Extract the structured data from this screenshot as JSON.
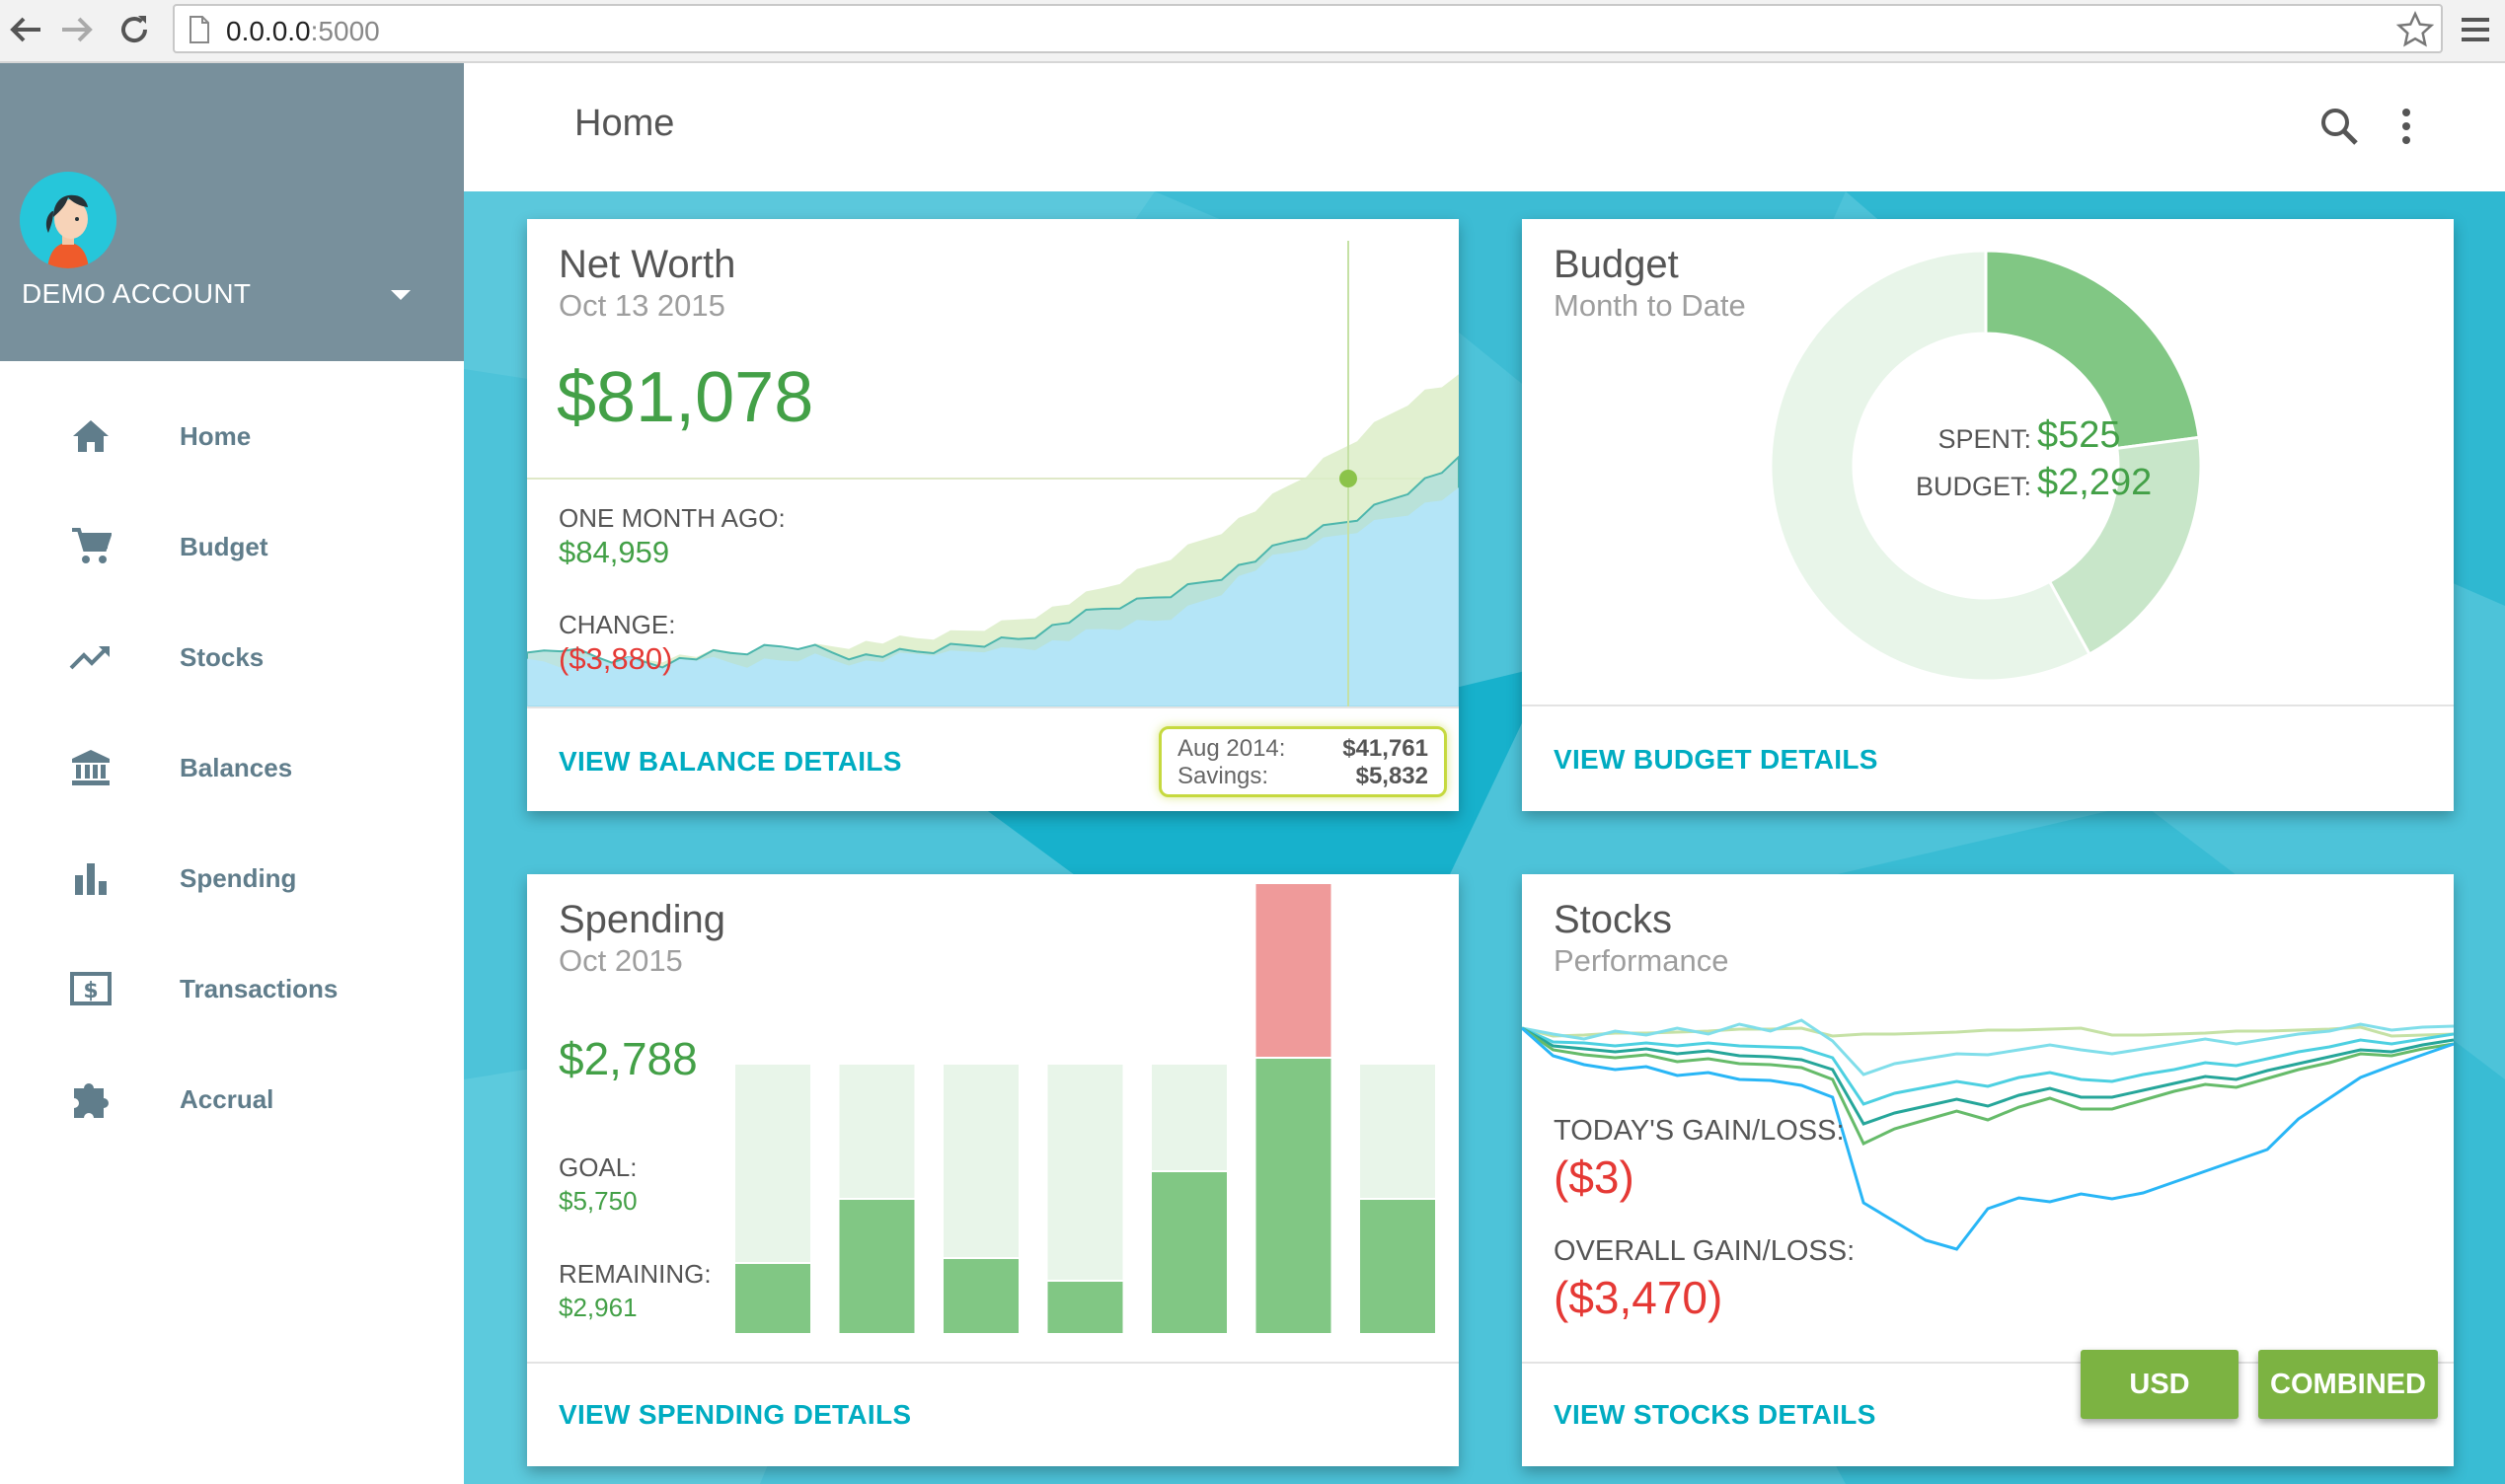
{
  "browser": {
    "url_host": "0.0.0.0",
    "url_port": ":5000"
  },
  "account": {
    "name": "DEMO ACCOUNT"
  },
  "nav": [
    {
      "label": "Home",
      "icon": "home-icon"
    },
    {
      "label": "Budget",
      "icon": "cart-icon"
    },
    {
      "label": "Stocks",
      "icon": "trending-up-icon"
    },
    {
      "label": "Balances",
      "icon": "bank-icon"
    },
    {
      "label": "Spending",
      "icon": "bar-chart-icon"
    },
    {
      "label": "Transactions",
      "icon": "dollar-bill-icon"
    },
    {
      "label": "Accrual",
      "icon": "puzzle-icon"
    }
  ],
  "header": {
    "title": "Home"
  },
  "net_worth": {
    "title": "Net Worth",
    "date": "Oct 13 2015",
    "value": "$81,078",
    "one_month_label": "ONE MONTH AGO:",
    "one_month_value": "$84,959",
    "change_label": "CHANGE:",
    "change_value": "($3,880)",
    "link": "VIEW BALANCE DETAILS",
    "tooltip": {
      "row1_label": "Aug 2014:",
      "row1_value": "$41,761",
      "row2_label": "Savings:",
      "row2_value": "$5,832"
    }
  },
  "budget": {
    "title": "Budget",
    "subtitle": "Month to Date",
    "spent_label": "SPENT:",
    "spent_value": "$525",
    "budget_label": "BUDGET:",
    "budget_value": "$2,292",
    "link": "VIEW BUDGET DETAILS"
  },
  "spending": {
    "title": "Spending",
    "subtitle": "Oct 2015",
    "value": "$2,788",
    "goal_label": "GOAL:",
    "goal_value": "$5,750",
    "remaining_label": "REMAINING:",
    "remaining_value": "$2,961",
    "link": "VIEW SPENDING DETAILS"
  },
  "stocks": {
    "title": "Stocks",
    "subtitle": "Performance",
    "today_label": "TODAY'S GAIN/LOSS:",
    "today_value": "($3)",
    "overall_label": "OVERALL GAIN/LOSS:",
    "overall_value": "($3,470)",
    "link": "VIEW STOCKS DETAILS",
    "usd_button": "USD",
    "combined_button": "COMBINED"
  },
  "colors": {
    "accent": "#00acc1",
    "positive": "#43a047",
    "negative": "#e53935",
    "sidebar_header": "#78909c",
    "background": "#4dc3d9",
    "button": "#7cb342"
  },
  "chart_data": [
    {
      "type": "donut",
      "categories": [
        "segment-1",
        "segment-2",
        "segment-3"
      ],
      "values": [
        22.9,
        19.1,
        58.0
      ],
      "colors": [
        "#81c784",
        "#c8e6c9",
        "#e8f5e9"
      ]
    },
    {
      "type": "bar",
      "stacked": true,
      "categories": [
        "1",
        "2",
        "3",
        "4",
        "5",
        "6",
        "7"
      ],
      "series": [
        {
          "color": "#81c784",
          "values": [
            72,
            137,
            77,
            54,
            165,
            280,
            137
          ]
        },
        {
          "color": "#e8f5e9",
          "values": [
            202,
            137,
            197,
            220,
            109,
            0,
            137
          ]
        },
        {
          "color": "#ef9a9a",
          "values": [
            0,
            0,
            0,
            0,
            0,
            177,
            0
          ]
        }
      ]
    },
    {
      "type": "area",
      "series": [
        {
          "color": "#b3e5fc",
          "values": [
            70,
            72,
            68,
            75,
            80,
            74,
            77,
            72,
            70,
            74,
            78,
            73,
            70,
            68,
            72,
            75,
            80,
            82,
            78,
            75,
            72,
            76,
            80,
            84,
            88,
            85,
            90,
            95,
            92,
            97,
            100,
            105,
            110,
            118,
            125,
            130,
            135,
            140,
            148,
            160,
            175,
            190,
            210,
            225,
            240,
            250,
            262,
            270,
            280,
            290,
            300,
            310,
            320,
            330,
            340,
            350
          ]
        },
        {
          "color": "#b2dfdb",
          "values": [
            80,
            90,
            95,
            88,
            82,
            78,
            76,
            74,
            72,
            76,
            80,
            84,
            86,
            90,
            94,
            98,
            100,
            96,
            90,
            85,
            82,
            84,
            86,
            88,
            92,
            96,
            100,
            104,
            108,
            112,
            120,
            130,
            140,
            150,
            158,
            165,
            170,
            178,
            185,
            195,
            205,
            215,
            228,
            240,
            255,
            268,
            280,
            290,
            300,
            310,
            325,
            340,
            355,
            370,
            385,
            400
          ]
        },
        {
          "color": "#dcedc8",
          "values": [
            60,
            64,
            66,
            70,
            72,
            74,
            76,
            78,
            80,
            82,
            84,
            86,
            88,
            90,
            92,
            94,
            96,
            98,
            100,
            102,
            104,
            106,
            108,
            110,
            114,
            118,
            124,
            130,
            136,
            144,
            152,
            160,
            170,
            180,
            192,
            205,
            218,
            232,
            246,
            260,
            275,
            290,
            305,
            322,
            340,
            360,
            380,
            400,
            420,
            440,
            460,
            480,
            500,
            515,
            525,
            535
          ]
        }
      ]
    },
    {
      "type": "line",
      "series": [
        {
          "color": "#c5e1a5",
          "values": [
            0,
            0,
            0,
            1,
            0,
            0,
            0,
            1,
            0,
            0,
            0,
            1,
            0,
            0,
            0,
            1,
            0,
            0,
            0,
            1,
            0,
            0,
            0,
            1,
            0,
            0,
            0,
            1,
            0,
            0,
            0
          ]
        },
        {
          "color": "#80deea",
          "values": [
            0,
            2,
            -4,
            3,
            -2,
            4,
            -3,
            6,
            -2,
            8,
            -5,
            -40,
            -30,
            -26,
            -22,
            -24,
            -20,
            -16,
            -22,
            -18,
            -14,
            -10,
            -6,
            -12,
            -8,
            -4,
            -2,
            4,
            6,
            8,
            8
          ]
        },
        {
          "color": "#4dd0e1",
          "values": [
            0,
            -6,
            -8,
            -12,
            -10,
            -14,
            -12,
            -16,
            -18,
            -20,
            -22,
            -70,
            -60,
            -55,
            -50,
            -56,
            -48,
            -44,
            -52,
            -46,
            -40,
            -36,
            -30,
            -34,
            -28,
            -22,
            -18,
            -12,
            -8,
            -4,
            0
          ]
        },
        {
          "color": "#26a69a",
          "values": [
            0,
            -10,
            -14,
            -18,
            -16,
            -22,
            -20,
            -26,
            -28,
            -32,
            -34,
            -90,
            -80,
            -74,
            -68,
            -76,
            -66,
            -60,
            -70,
            -62,
            -56,
            -50,
            -44,
            -48,
            -40,
            -34,
            -28,
            -22,
            -16,
            -10,
            -6
          ]
        },
        {
          "color": "#66bb6a",
          "values": [
            0,
            -14,
            -20,
            -24,
            -22,
            -30,
            -28,
            -34,
            -36,
            -40,
            -44,
            -110,
            -96,
            -88,
            -80,
            -90,
            -78,
            -70,
            -82,
            -74,
            -66,
            -58,
            -52,
            -56,
            -48,
            -40,
            -34,
            -26,
            -20,
            -14,
            -10
          ]
        },
        {
          "color": "#29b6f6",
          "values": [
            0,
            -20,
            -30,
            -36,
            -34,
            -44,
            -42,
            -50,
            -52,
            -58,
            -62,
            -170,
            -190,
            -210,
            -220,
            -180,
            -170,
            -175,
            -168,
            -165,
            -160,
            -150,
            -140,
            -130,
            -120,
            -90,
            -70,
            -50,
            -30,
            -20,
            -10
          ]
        }
      ]
    }
  ]
}
